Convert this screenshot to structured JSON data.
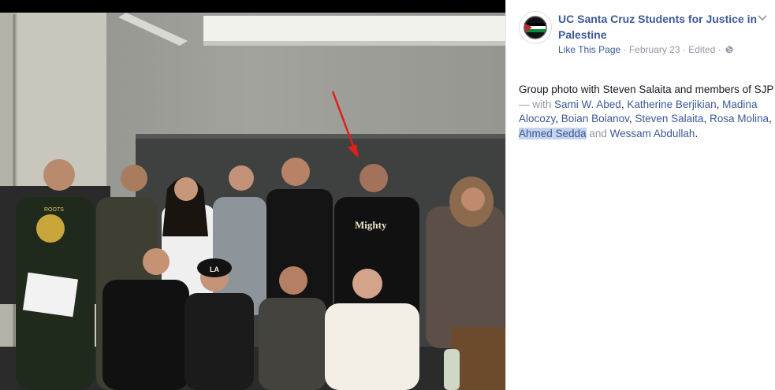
{
  "post": {
    "page_name": "UC Santa Cruz Students for Justice in Palestine",
    "like_label": "Like This Page",
    "sep": " · ",
    "date": "February 23",
    "edited": "Edited",
    "caption_prefix": "Group photo with Steven Salaita and members of SJP",
    "with_label": " — with ",
    "tags": [
      {
        "name": "Sami W. Abed",
        "after": ", "
      },
      {
        "name": "Katherine Berjikian",
        "after": ", "
      },
      {
        "name": "Madina Alocozy",
        "after": ", "
      },
      {
        "name": "Boian Boianov",
        "after": ", "
      },
      {
        "name": "Steven Salaita",
        "after": ", "
      },
      {
        "name": "Rosa Molina",
        "after": ", "
      },
      {
        "name": "Ahmed Sedda",
        "after": " "
      }
    ],
    "and_label": "and",
    "last_tag": "Wessam Abdullah",
    "end": ".",
    "highlighted_tag": "Ahmed Sedda"
  },
  "photo": {
    "shirt_text_left": "ROOTS",
    "shirt_text_right": "Mighty",
    "beanie_text": "LA"
  },
  "colors": {
    "link": "#3b5998",
    "meta": "#9197a3",
    "highlight": "#c5d3ec",
    "arrow": "#e0201a"
  },
  "icons": [
    "chevron-down-icon",
    "globe-icon",
    "page-avatar-icon"
  ]
}
